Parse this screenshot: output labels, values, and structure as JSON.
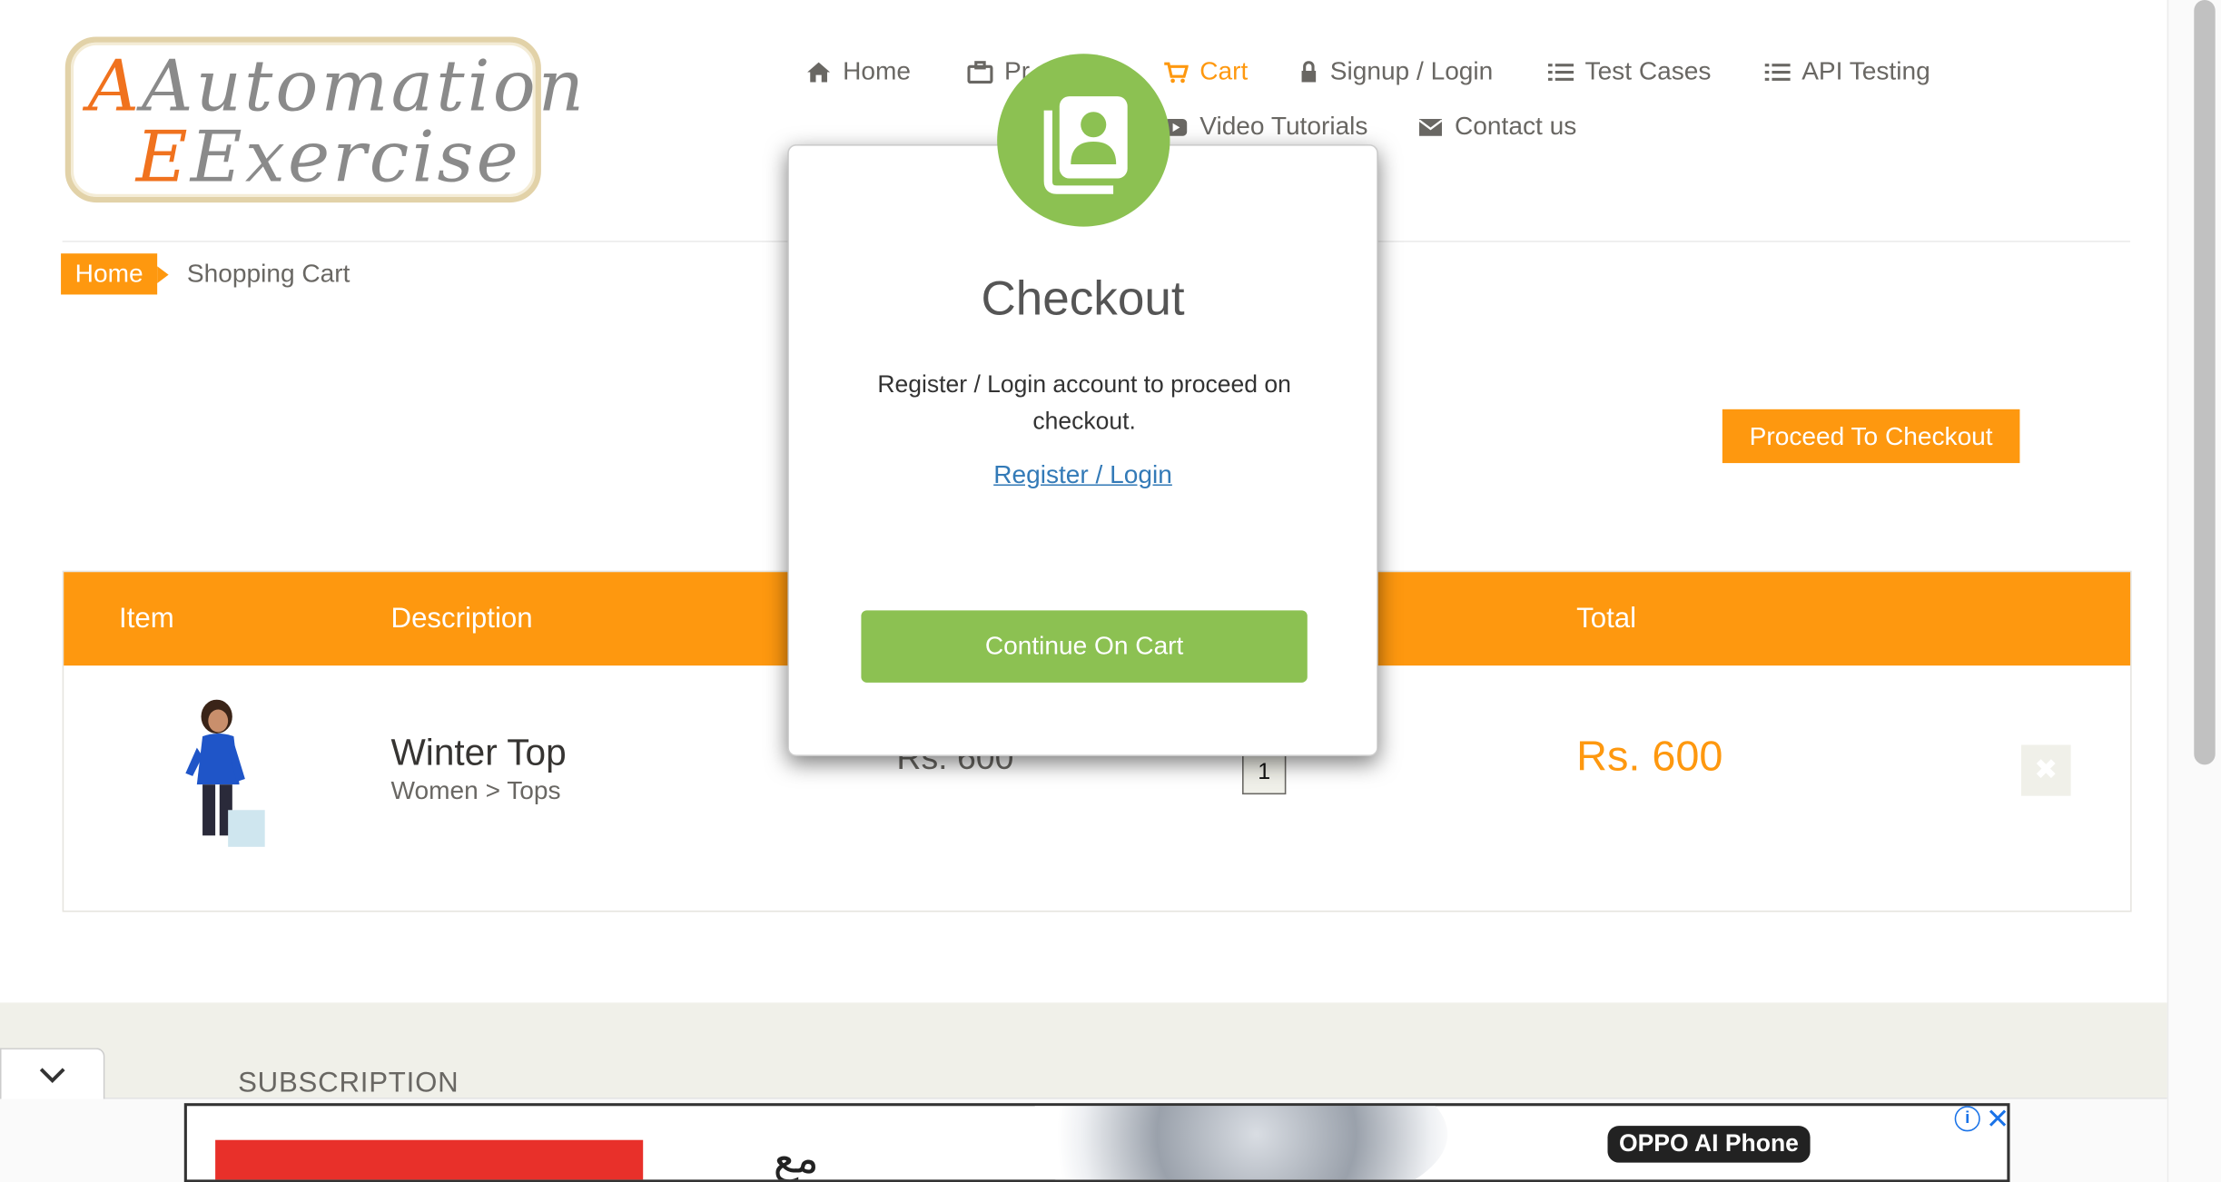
{
  "logo": {
    "line1": "Automation",
    "line2": "Exercise"
  },
  "nav": {
    "home": "Home",
    "products": "Pr",
    "cart": "Cart",
    "signup": "Signup / Login",
    "test_cases": "Test Cases",
    "api_testing": "API Testing",
    "video": "Video Tutorials",
    "contact": "Contact us"
  },
  "breadcrumb": {
    "home": "Home",
    "current": "Shopping Cart"
  },
  "actions": {
    "proceed": "Proceed To Checkout"
  },
  "table": {
    "headers": {
      "item": "Item",
      "description": "Description",
      "total": "Total"
    },
    "rows": [
      {
        "name": "Winter Top",
        "category": "Women > Tops",
        "price": "Rs. 600",
        "quantity": "1",
        "total": "Rs. 600",
        "delete_icon": "close-icon"
      }
    ]
  },
  "footer": {
    "subscription": "SUBSCRIPTION"
  },
  "ad": {
    "arabic": "مع",
    "brand": "OPPO AI Phone",
    "info": "i",
    "close": "✕"
  },
  "modal": {
    "title": "Checkout",
    "message": "Register / Login account to proceed on checkout.",
    "link": "Register / Login",
    "continue": "Continue On Cart",
    "icon": "contacts-icon"
  },
  "colors": {
    "brand_orange": "#fe980f",
    "modal_green": "#8cc152",
    "link_blue": "#337ab7"
  }
}
